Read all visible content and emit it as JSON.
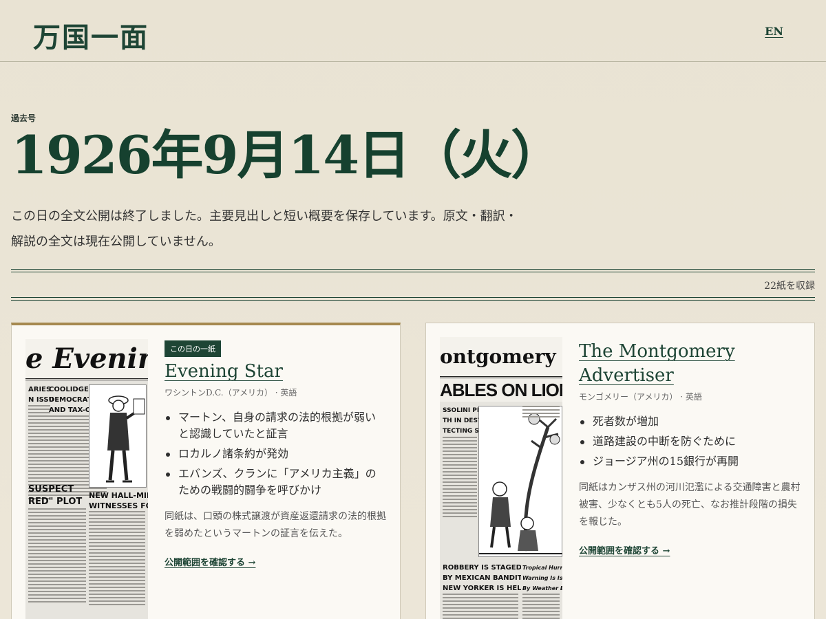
{
  "header": {
    "logo": "万国一面",
    "lang_label": "EN"
  },
  "issue": {
    "kicker": "過去号",
    "date_title": "1926年9月14日（火）",
    "notice": "この日の全文公開は終了しました。主要見出しと短い概要を保存しています。原文・翻訳・解説の全文は現在公開していません。",
    "count_label": "22紙を収録"
  },
  "papers": [
    {
      "badge": "この日の一紙",
      "name": "Evening Star",
      "meta": "ワシントンD.C.（アメリカ） · 英語",
      "headlines": [
        "マートン、自身の請求の法的根拠が弱いと認識していたと証言",
        "ロカルノ諸条約が発効",
        "エバンズ、クランに「アメリカ主義」のための戦闘的闘争を呼びかけ"
      ],
      "summary": "同紙は、口頭の株式譲渡が資産返還請求の法的根拠を弱めたというマートンの証言を伝えた。",
      "more_label": "公開範囲を確認する →",
      "thumb": {
        "masthead": "e Evening St",
        "col1": [
          "COOLIDGE OPPOSES",
          "DEMOCRATIC DEBT",
          "AND TAX-CUT PLAN"
        ],
        "col2": "NEW HALL-MILLS",
        "col2b": "WITNESSES FOUND",
        "left_bits": [
          "ARIES",
          "N ISSUES"
        ],
        "lower_left": "SUSPECT",
        "lower_left2": "RED\" PLOT"
      }
    },
    {
      "badge": "",
      "name": "The Montgomery Advertiser",
      "meta": "モンゴメリー（アメリカ） · 英語",
      "headlines": [
        "死者数が増加",
        "道路建設の中断を防ぐために",
        "ジョージア州の15銀行が再開"
      ],
      "summary": "同紙はカンザス州の河川氾濫による交通障害と農村被害、少なくとも5人の死亡、なお推計段階の損失を報じた。",
      "more_label": "公開範囲を確認する →",
      "thumb": {
        "masthead": "ontgomery Adve",
        "banner": "ABLES ON LIONS V",
        "sub": [
          "SSOLINI PLACES",
          "TH IN DESTINY'S",
          "TECTING STAR"
        ],
        "lower": [
          "ROBBERY IS STAGED",
          "BY MEXICAN BANDITS",
          "NEW YORKER IS HELD"
        ],
        "lower_right": [
          "Tropical Hurricane",
          "Warning Is Issued",
          "By Weather Bureau"
        ]
      }
    }
  ]
}
